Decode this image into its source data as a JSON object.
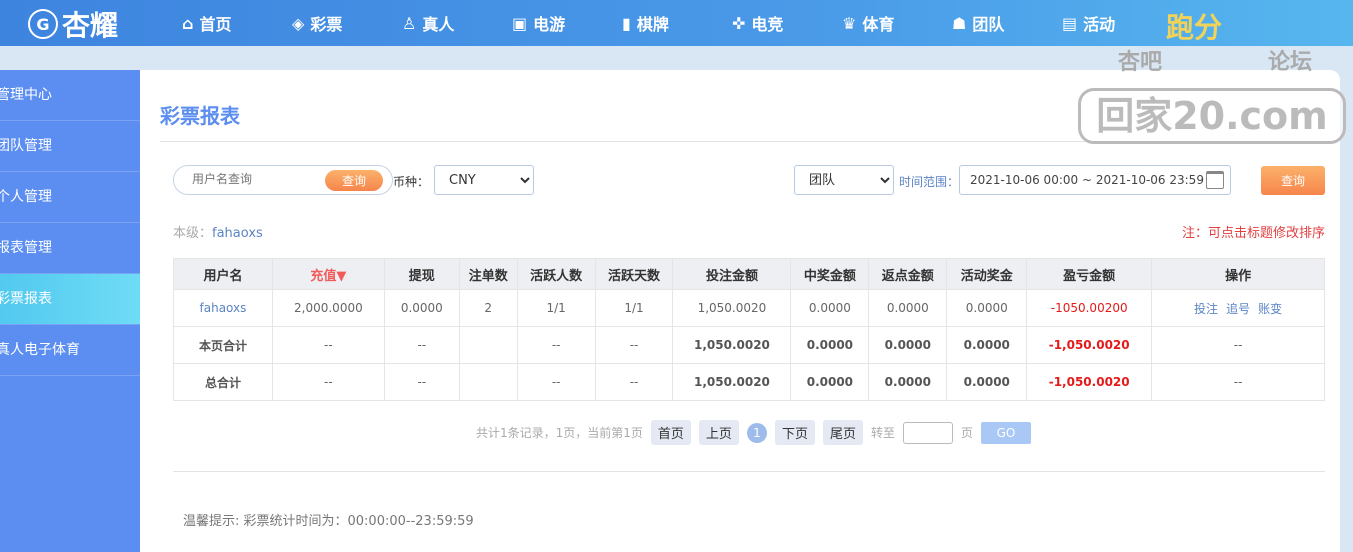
{
  "brand": {
    "logo": "杏耀",
    "logo_badge": "G"
  },
  "nav": [
    {
      "label": "首页",
      "icon": "home-icon",
      "glyph": "⌂"
    },
    {
      "label": "彩票",
      "icon": "ticket-icon",
      "glyph": "◈"
    },
    {
      "label": "真人",
      "icon": "person-icon",
      "glyph": "♙"
    },
    {
      "label": "电游",
      "icon": "slot-icon",
      "glyph": "▣"
    },
    {
      "label": "棋牌",
      "icon": "card-icon",
      "glyph": "▮"
    },
    {
      "label": "电竞",
      "icon": "gamepad-icon",
      "glyph": "✜"
    },
    {
      "label": "体育",
      "icon": "trophy-icon",
      "glyph": "♛"
    },
    {
      "label": "团队",
      "icon": "team-icon",
      "glyph": "☗"
    },
    {
      "label": "活动",
      "icon": "gift-icon",
      "glyph": "▤"
    }
  ],
  "paofen": "跑分",
  "watermark": {
    "t1": "杏吧",
    "t2": "论坛",
    "t3": "回家20.com"
  },
  "sidebar": [
    "管理中心",
    "团队管理",
    "个人管理",
    "报表管理",
    "彩票报表",
    "真人电子体育"
  ],
  "page_title": "彩票报表",
  "filters": {
    "username_placeholder": "用户名查询",
    "search_label": "查询",
    "currency_label": "币种：",
    "currency": "CNY",
    "scope": "团队",
    "range_label": "时间范围：",
    "range": "2021-10-06 00:00 ~ 2021-10-06 23:59",
    "query_label": "查询"
  },
  "level": {
    "label": "本级：",
    "user": "fahaoxs"
  },
  "note": "注：可点击标题修改排序",
  "table": {
    "headers": [
      "用户名",
      "充值▼",
      "提现",
      "注单数",
      "活跃人数",
      "活跃天数",
      "投注金额",
      "中奖金额",
      "返点金额",
      "活动奖金",
      "盈亏金额",
      "操作"
    ],
    "rows": [
      [
        "fahaoxs",
        "2,000.0000",
        "0.0000",
        "2",
        "1/1",
        "1/1",
        "1,050.0020",
        "0.0000",
        "0.0000",
        "0.0000",
        "-1050.00200"
      ],
      [
        "本页合计",
        "--",
        "--",
        "",
        "--",
        "--",
        "1,050.0020",
        "0.0000",
        "0.0000",
        "0.0000",
        "-1,050.0020",
        "--"
      ],
      [
        "总合计",
        "--",
        "--",
        "",
        "--",
        "--",
        "1,050.0020",
        "0.0000",
        "0.0000",
        "0.0000",
        "-1,050.0020",
        "--"
      ]
    ],
    "actions": [
      "投注",
      "追号",
      "账变"
    ]
  },
  "pager": {
    "summary": "共计1条记录，1页，当前第1页",
    "first": "首页",
    "prev": "上页",
    "current": "1",
    "next": "下页",
    "last": "尾页",
    "goto": "转至",
    "page": "页",
    "go": "GO"
  },
  "tip": "温馨提示: 彩票统计时间为：00:00:00--23:59:59"
}
